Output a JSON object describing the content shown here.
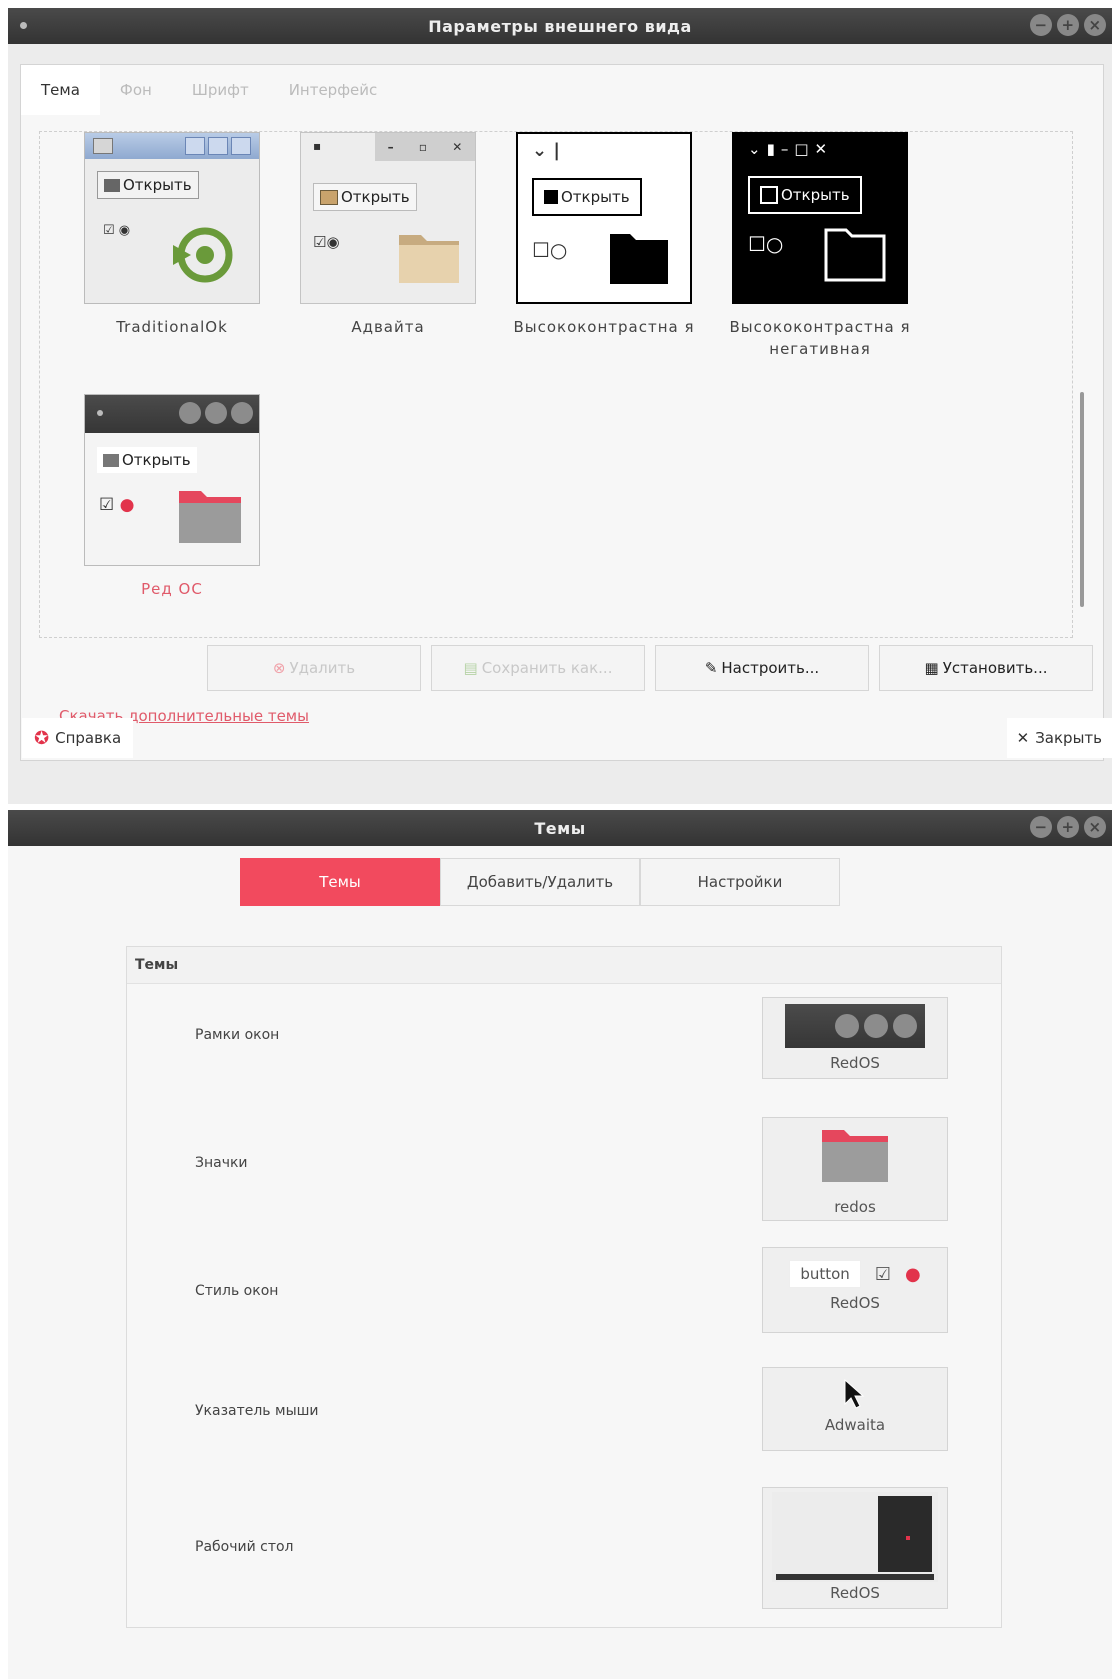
{
  "appearance": {
    "title": "Параметры внешнего вида",
    "tabs": [
      "Тема",
      "Фон",
      "Шрифт",
      "Интерфейс"
    ],
    "themes": [
      {
        "name": "TraditionalOk",
        "open_label": "Открыть"
      },
      {
        "name": "Адвайта",
        "open_label": "Открыть"
      },
      {
        "name": "Высококонтрастна я",
        "open_label": "Открыть"
      },
      {
        "name": "Высококонтрастна я негативная",
        "open_label": "Открыть"
      },
      {
        "name": "Ред ОС",
        "open_label": "Открыть"
      }
    ],
    "buttons": {
      "delete": "Удалить",
      "save_as": "Сохранить как...",
      "customize": "Настроить...",
      "install": "Установить..."
    },
    "download_link": "Скачать дополнительные темы",
    "help": "Справка",
    "close": "Закрыть"
  },
  "themes_window": {
    "title": "Темы",
    "segments": [
      "Темы",
      "Добавить/Удалить",
      "Настройки"
    ],
    "active_segment": "Темы",
    "group_title": "Темы",
    "rows": [
      {
        "label": "Рамки окон",
        "value": "RedOS"
      },
      {
        "label": "Значки",
        "value": "redos"
      },
      {
        "label": "Стиль окон",
        "value": "RedOS",
        "sample_button": "button"
      },
      {
        "label": "Указатель мыши",
        "value": "Adwaita"
      },
      {
        "label": "Рабочий стол",
        "value": "RedOS"
      }
    ]
  },
  "colors": {
    "accent": "#f24a5e",
    "titlebar": "#3c3c3c",
    "link": "#e05a6a"
  }
}
